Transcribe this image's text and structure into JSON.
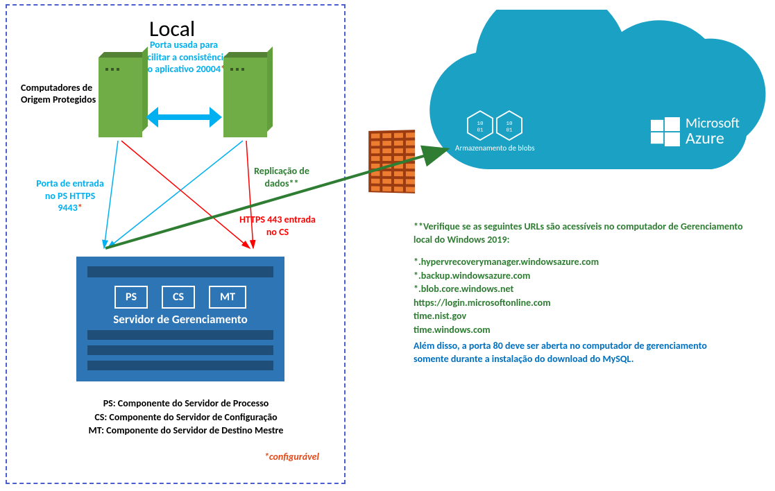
{
  "local": {
    "title": "Local",
    "port_used": "Porta usada para facilitar a consistência do aplicativo 20004",
    "protected_src": "Computadores de Origem Protegidos",
    "port_ps": "Porta de entrada no PS HTTPS 9443",
    "replication": "Replicação de dados**",
    "https443": "HTTPS 443 entrada no CS"
  },
  "mgmt": {
    "ps": "PS",
    "cs": "CS",
    "mt": "MT",
    "label": "Servidor de Gerenciamento"
  },
  "legend": {
    "ps": "PS: Componente do Servidor de Processo",
    "cs": "CS: Componente do Servidor de Configuração",
    "mt": "MT: Componente do Servidor de Destino Mestre"
  },
  "config_note": "*configurável",
  "cloud": {
    "blob_label": "Armazenamento de blobs",
    "azure_brand_1": "Microsoft",
    "azure_brand_2": "Azure"
  },
  "verify": "**Verifique se as seguintes URLs são acessíveis no computador de Gerenciamento local do Windows 2019:",
  "urls": {
    "u1": "*.hypervrecoverymanager.windowsazure.com",
    "u2": "*.backup.windowsazure.com",
    "u3": "*.blob.core.windows.net",
    "u4": "https://login.microsoftonline.com",
    "u5": "time.nist.gov",
    "u6": "time.windows.com"
  },
  "port80": "Além disso, a porta 80 deve ser aberta no computador de gerenciamento somente durante a instalação do download do MySQL."
}
